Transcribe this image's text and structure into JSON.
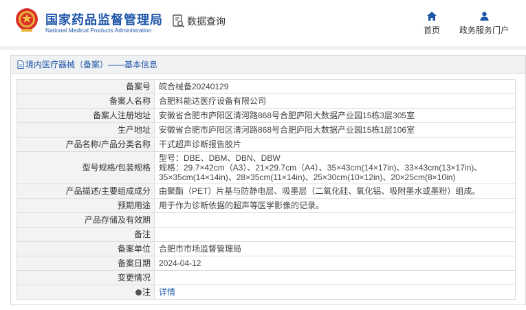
{
  "header": {
    "brand_cn": "国家药品监督管理局",
    "brand_en": "National Medical Products Administration",
    "query_label": "数据查询",
    "nav": [
      {
        "label": "首页",
        "icon": "home-icon"
      },
      {
        "label": "政务服务门户",
        "icon": "user-icon"
      }
    ],
    "brand_color": "#1e56a8"
  },
  "panel": {
    "title": "境内医疗器械（备案）——基本信息"
  },
  "rows": [
    {
      "key": "备案号",
      "value": "皖合械备20240129"
    },
    {
      "key": "备案人名称",
      "value": "合肥科能达医疗设备有限公司"
    },
    {
      "key": "备案人注册地址",
      "value": "安徽省合肥市庐阳区清河路868号合肥庐阳大数据产业园15栋3层305室"
    },
    {
      "key": "生产地址",
      "value": "安徽省合肥市庐阳区清河路868号合肥庐阳大数据产业园15栋1层106室"
    },
    {
      "key": "产品名称/产品分类名称",
      "value": "干式超声诊断报告胶片"
    },
    {
      "key": "型号规格/包装规格",
      "lines": [
        "型号：DBE、DBM、DBN、DBW",
        "规格：29.7×42cm（A3）、21×29.7cm（A4）、35×43cm(14×17in)、33×43cm(13×17in)、",
        "35×35cm(14×14in)、28×35cm(11×14in)、25×30cm(10×12in)、20×25cm(8×10in)"
      ]
    },
    {
      "key": "产品描述/主要组成成分",
      "value": "由聚酯（PET）片基与防静电层、吸墨层（二氧化硅、氧化铝、吸附墨水或墨粉）组成。"
    },
    {
      "key": "预期用途",
      "value": "用于作为诊断依据的超声等医学影像的记录。"
    },
    {
      "key": "产品存储及有效期",
      "value": ""
    },
    {
      "key": "备注",
      "value": ""
    },
    {
      "key": "备案单位",
      "value": "合肥市市场监督管理局"
    },
    {
      "key": "备案日期",
      "value": "2024-04-12"
    },
    {
      "key": "变更情况",
      "value": ""
    },
    {
      "key": "注",
      "value": "详情"
    }
  ]
}
